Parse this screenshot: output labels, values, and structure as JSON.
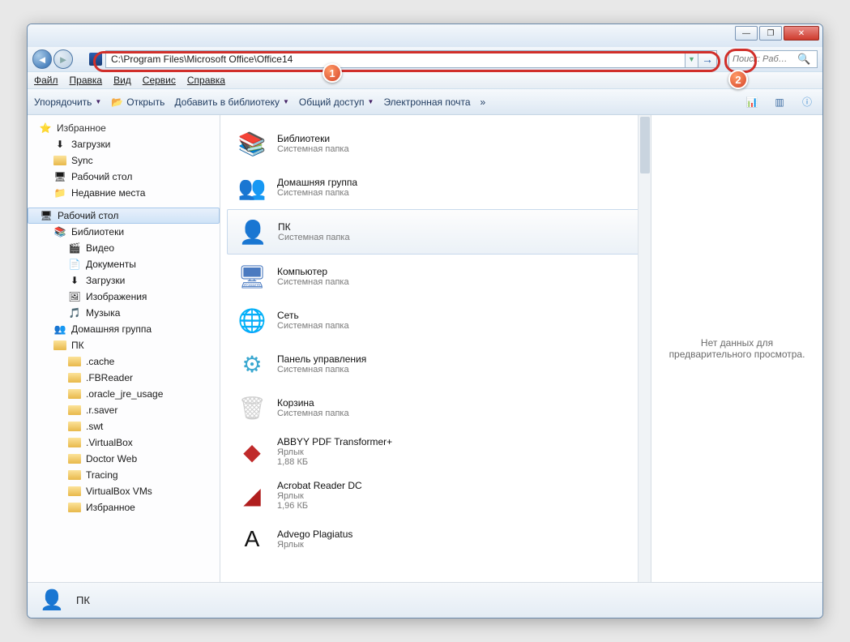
{
  "titlebar": {
    "min": "—",
    "max": "❐",
    "close": "✕"
  },
  "nav": {
    "address": "C:\\Program Files\\Microsoft Office\\Office14",
    "search_placeholder": "Поиск: Раб…"
  },
  "menu": {
    "file": "Файл",
    "edit": "Правка",
    "view": "Вид",
    "service": "Сервис",
    "help": "Справка"
  },
  "toolbar": {
    "organize": "Упорядочить",
    "open": "Открыть",
    "library": "Добавить в библиотеку",
    "share": "Общий доступ",
    "email": "Электронная почта",
    "overflow": "»"
  },
  "tree": {
    "favorites": "Избранное",
    "downloads": "Загрузки",
    "sync": "Sync",
    "desktop_fav": "Рабочий стол",
    "recent": "Недавние места",
    "desktop_hdr": "Рабочий стол",
    "libraries": "Библиотеки",
    "video": "Видео",
    "documents": "Документы",
    "downloads2": "Загрузки",
    "images": "Изображения",
    "music": "Музыка",
    "homegroup": "Домашняя группа",
    "pc": "ПК",
    "cache": ".cache",
    "fbreader": ".FBReader",
    "oracle": ".oracle_jre_usage",
    "rsaver": ".r.saver",
    "swt": ".swt",
    "virtualbox": ".VirtualBox",
    "doctorweb": "Doctor Web",
    "tracing": "Tracing",
    "vboxvms": "VirtualBox VMs",
    "favorites2": "Избранное"
  },
  "items": [
    {
      "name": "Библиотеки",
      "sub": "Системная папка",
      "icon": "📚",
      "color": "#e8b84a"
    },
    {
      "name": "Домашняя группа",
      "sub": "Системная папка",
      "icon": "👥",
      "color": "#4aa84a"
    },
    {
      "name": "ПК",
      "sub": "Системная папка",
      "icon": "👤",
      "color": "#e8b84a",
      "selected": true
    },
    {
      "name": "Компьютер",
      "sub": "Системная папка",
      "icon": "🖥",
      "color": "#4a7ac0"
    },
    {
      "name": "Сеть",
      "sub": "Системная папка",
      "icon": "🌐",
      "color": "#3a7ac0"
    },
    {
      "name": "Панель управления",
      "sub": "Системная папка",
      "icon": "⚙",
      "color": "#3aa8d0"
    },
    {
      "name": "Корзина",
      "sub": "Системная папка",
      "icon": "🗑",
      "color": "#d0d0d0"
    },
    {
      "name": "ABBYY PDF Transformer+",
      "sub": "Ярлык",
      "sub2": "1,88 КБ",
      "icon": "◆",
      "color": "#c02a2a"
    },
    {
      "name": "Acrobat Reader DC",
      "sub": "Ярлык",
      "sub2": "1,96 КБ",
      "icon": "◢",
      "color": "#b01e1e"
    },
    {
      "name": "Advego Plagiatus",
      "sub": "Ярлык",
      "icon": "A",
      "color": "#111"
    }
  ],
  "preview": {
    "text": "Нет данных для предварительного просмотра."
  },
  "status": {
    "name": "ПК"
  },
  "callouts": {
    "badge1": "1",
    "badge2": "2"
  }
}
